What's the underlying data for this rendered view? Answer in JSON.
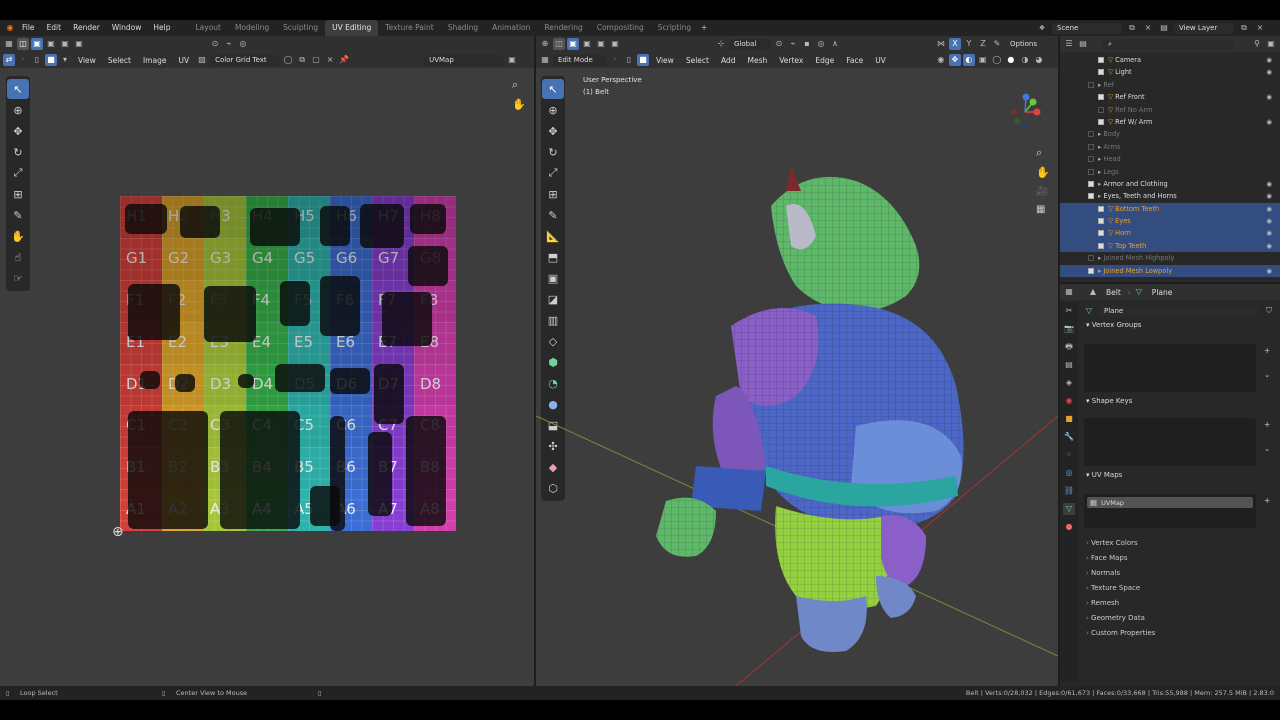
{
  "topbar": {
    "menus": [
      "File",
      "Edit",
      "Render",
      "Window",
      "Help"
    ],
    "workspaces": [
      "Layout",
      "Modeling",
      "Sculpting",
      "UV Editing",
      "Texture Paint",
      "Shading",
      "Animation",
      "Rendering",
      "Compositing",
      "Scripting"
    ],
    "active_workspace": "UV Editing",
    "scene": "Scene",
    "view_layer": "View Layer"
  },
  "uv_editor": {
    "menus": [
      "View",
      "Select",
      "Image",
      "UV"
    ],
    "image_name": "Color Grid Text",
    "uvmap": "UVMap",
    "grid_labels": [
      [
        "H1",
        "H2",
        "H3",
        "H4",
        "H5",
        "H6",
        "H7",
        "H8"
      ],
      [
        "G1",
        "G2",
        "G3",
        "G4",
        "G5",
        "G6",
        "G7",
        "G8"
      ],
      [
        "F1",
        "F2",
        "F3",
        "F4",
        "F5",
        "F6",
        "F7",
        "F8"
      ],
      [
        "E1",
        "E2",
        "E3",
        "E4",
        "E5",
        "E6",
        "E7",
        "E8"
      ],
      [
        "D1",
        "D2",
        "D3",
        "D4",
        "D5",
        "D6",
        "D7",
        "D8"
      ],
      [
        "C1",
        "C2",
        "C3",
        "C4",
        "C5",
        "C6",
        "C7",
        "C8"
      ],
      [
        "B1",
        "B2",
        "B3",
        "B4",
        "B5",
        "B6",
        "B7",
        "B8"
      ],
      [
        "A1",
        "A2",
        "A3",
        "A4",
        "A5",
        "A6",
        "A7",
        "A8"
      ]
    ],
    "column_colors": [
      "#d8413a",
      "#e0a62a",
      "#a9c93a",
      "#37b24a",
      "#2fb7b0",
      "#3d6fd6",
      "#8a3fd6",
      "#d63fb0"
    ]
  },
  "viewport": {
    "mode": "Edit Mode",
    "menus": [
      "View",
      "Select",
      "Add",
      "Mesh",
      "Vertex",
      "Edge",
      "Face",
      "UV"
    ],
    "orientation": "Global",
    "options_label": "Options",
    "perspective": "User Perspective",
    "object": "(1) Belt",
    "axes": {
      "x": "X",
      "y": "Y",
      "z": "Z"
    }
  },
  "outliner": {
    "rows": [
      {
        "label": "Camera",
        "state": "normal",
        "indent": 2
      },
      {
        "label": "Light",
        "state": "normal",
        "indent": 2
      },
      {
        "label": "Ref",
        "state": "dim",
        "indent": 1
      },
      {
        "label": "Ref Front",
        "state": "normal",
        "indent": 2
      },
      {
        "label": "Ref No Arm",
        "state": "dim",
        "indent": 2
      },
      {
        "label": "Ref W/ Arm",
        "state": "normal",
        "indent": 2
      },
      {
        "label": "Body",
        "state": "dim",
        "indent": 1
      },
      {
        "label": "Arms",
        "state": "dim",
        "indent": 1
      },
      {
        "label": "Head",
        "state": "dim",
        "indent": 1
      },
      {
        "label": "Legs",
        "state": "dim",
        "indent": 1
      },
      {
        "label": "Armor and Clothing",
        "state": "normal",
        "indent": 1
      },
      {
        "label": "Eyes, Teeth and Horns",
        "state": "normal",
        "indent": 1
      },
      {
        "label": "Bottom Teeth",
        "state": "sel",
        "indent": 2
      },
      {
        "label": "Eyes",
        "state": "seldim",
        "indent": 2
      },
      {
        "label": "Horn",
        "state": "sel",
        "indent": 2
      },
      {
        "label": "Top Teeth",
        "state": "seldim",
        "indent": 2
      },
      {
        "label": "Joined Mesh Highpoly",
        "state": "dim",
        "indent": 1
      },
      {
        "label": "Joined Mesh Lowpoly",
        "state": "sel",
        "indent": 1
      }
    ]
  },
  "properties": {
    "breadcrumb": [
      "Belt",
      "Plane"
    ],
    "data_name": "Plane",
    "panels": {
      "vertex_groups": "Vertex Groups",
      "shape_keys": "Shape Keys",
      "uv_maps": "UV Maps"
    },
    "uv_map_item": "UVMap",
    "collapsed": [
      "Vertex Colors",
      "Face Maps",
      "Normals",
      "Texture Space",
      "Remesh",
      "Geometry Data",
      "Custom Properties"
    ]
  },
  "statusbar": {
    "left": "Loop Select",
    "middle": "Center View to Mouse",
    "right": "Belt | Verts:0/28,032 | Edges:0/61,673 | Faces:0/33,668 | Tris:55,988 | Mem: 257.5 MiB | 2.83.0"
  }
}
